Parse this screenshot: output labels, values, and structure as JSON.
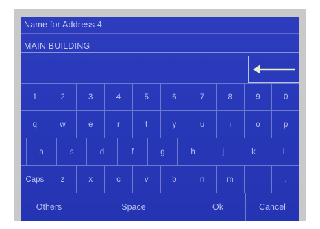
{
  "address": {
    "label": "Name for Address 4 :",
    "value": "MAIN  BUILDING"
  },
  "backspace_icon": "left-arrow",
  "keyboard": {
    "row1": [
      "1",
      "2",
      "3",
      "4",
      "5",
      "6",
      "7",
      "8",
      "9",
      "0"
    ],
    "row2": [
      "q",
      "w",
      "e",
      "r",
      "t",
      "y",
      "u",
      "i",
      "o",
      "p"
    ],
    "row3": [
      "a",
      "s",
      "d",
      "f",
      "g",
      "h",
      "j",
      "k",
      "l"
    ],
    "row4": [
      "Caps",
      "z",
      "x",
      "c",
      "v",
      "b",
      "n",
      "m",
      ",",
      "."
    ],
    "bottom": {
      "others": "Others",
      "space": "Space",
      "ok": "Ok",
      "cancel": "Cancel"
    }
  },
  "colors": {
    "screen": "#2a3ab9",
    "text": "#c6cbf0",
    "arrow": "#e8f3cf",
    "key_border": "#6e78cf"
  }
}
